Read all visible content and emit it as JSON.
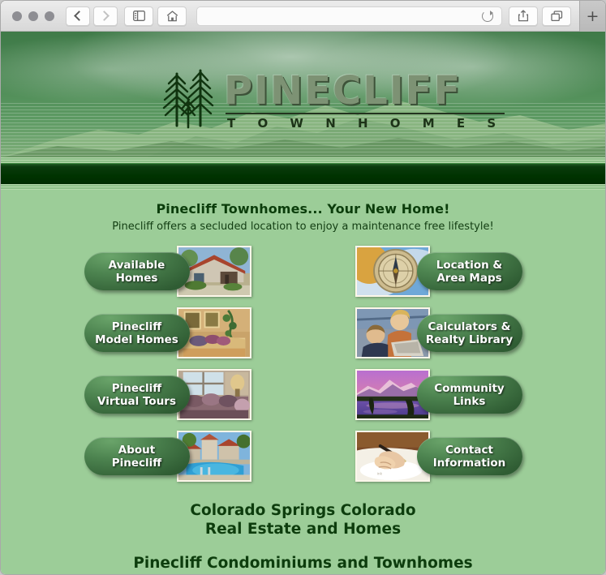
{
  "browser": {
    "traffic_lights": [
      "close",
      "minimize",
      "zoom"
    ],
    "back_label": "Back",
    "forward_label": "Forward",
    "sidebar_label": "Show Sidebar",
    "home_label": "Home",
    "url_value": "",
    "url_placeholder": "",
    "reload_label": "Reload",
    "share_label": "Share",
    "tabs_label": "Show Tab Overview",
    "new_tab_label": "+"
  },
  "site": {
    "logo_title": "PINECLIFF",
    "logo_subtitle": "T O W N H O M E S"
  },
  "headline": {
    "title": "Pinecliff Townhomes... Your New Home!",
    "subtitle": "Pinecliff offers a secluded location to enjoy a maintenance free lifestyle!"
  },
  "nav_left": [
    {
      "label": "Available\nHomes",
      "label_line1": "Available",
      "label_line2": "Homes",
      "thumb": "stucco-home-photo"
    },
    {
      "label": "Pinecliff\nModel Homes",
      "label_line1": "Pinecliff",
      "label_line2": "Model Homes",
      "thumb": "bedroom-interior-photo"
    },
    {
      "label": "Pinecliff\nVirtual Tours",
      "label_line1": "Pinecliff",
      "label_line2": "Virtual Tours",
      "thumb": "living-room-window-photo"
    },
    {
      "label": "About\nPinecliff",
      "label_line1": "About",
      "label_line2": "Pinecliff",
      "thumb": "pool-house-photo"
    }
  ],
  "nav_right": [
    {
      "label": "Location &\nArea Maps",
      "label_line1": "Location &",
      "label_line2": "Area Maps",
      "thumb": "compass-photo"
    },
    {
      "label": "Calculators &\nRealty Library",
      "label_line1": "Calculators &",
      "label_line2": "Realty Library",
      "thumb": "couple-at-computer-photo"
    },
    {
      "label": "Community\nLinks",
      "label_line1": "Community",
      "label_line2": "Links",
      "thumb": "sunset-mountain-lake-photo"
    },
    {
      "label": "Contact\nInformation",
      "label_line1": "Contact",
      "label_line2": "Information",
      "thumb": "hands-writing-photo"
    }
  ],
  "footer": {
    "line1": "Colorado Springs Colorado",
    "line2": "Real Estate and Homes",
    "line3": "Pinecliff Condominiums and Townhomes"
  },
  "colors": {
    "page_background": "#9ccd98",
    "dark_bar": "#003300",
    "pill_light": "#6aa46a",
    "pill_dark": "#2f5c33",
    "heading_text": "#0b3d0b",
    "pill_text": "#ffffff"
  }
}
